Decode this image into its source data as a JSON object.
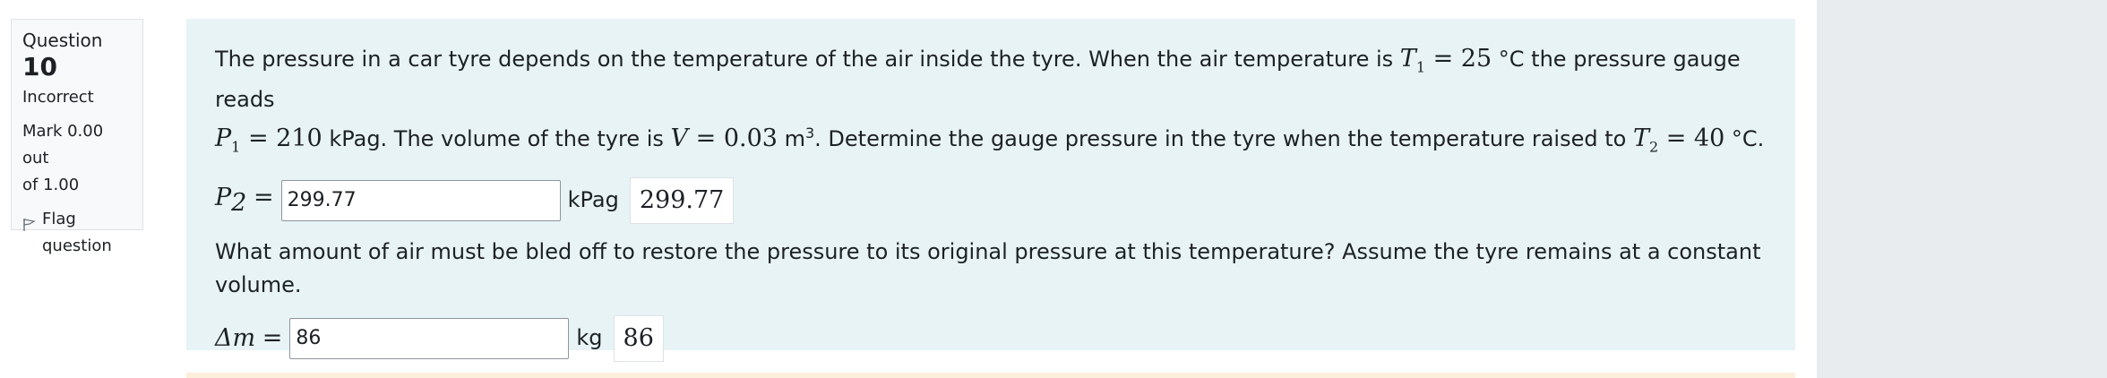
{
  "info": {
    "question_label": "Question",
    "question_number": "10",
    "state": "Incorrect",
    "grade_line1": "Mark 0.00 out",
    "grade_line2": "of 1.00",
    "flag_line1": "Flag",
    "flag_line2": "question"
  },
  "question": {
    "p1_a": "The pressure in a car tyre depends on the temperature of the air inside the tyre. When the air temperature is ",
    "t1_var": "T",
    "t1_sub": "1",
    "t1_eq": " = 25",
    "t1_unit": " °C the pressure gauge reads",
    "p1_var": "P",
    "p1_sub": "1",
    "p1_eq": " = 210",
    "p1_unit": " kPag. The volume of the tyre is ",
    "v_var": "V",
    "v_eq": " = 0.03",
    "v_unit": " m",
    "v_sup": "3",
    "p1_b": ". Determine the gauge pressure in the tyre when the temperature raised to ",
    "t2_var": "T",
    "t2_sub": "2",
    "t2_eq": " = 40",
    "t2_unit": " °C.",
    "part2_text": "What amount of air must be bled off to restore the pressure to its original pressure at this temperature? Assume the tyre remains at a constant volume."
  },
  "answer1": {
    "label_var": "P",
    "label_sub": "2",
    "label_eq": "=",
    "value": "299.77",
    "unit": "kPag",
    "shown": "299.77"
  },
  "answer2": {
    "label_var": "Δm",
    "label_eq": "=",
    "value": "86",
    "unit": "kg",
    "shown": "86"
  },
  "colors": {
    "formulation_bg": "#e7f3f5",
    "info_bg": "#f8f9fa",
    "side_panel": "#e9ecef"
  }
}
